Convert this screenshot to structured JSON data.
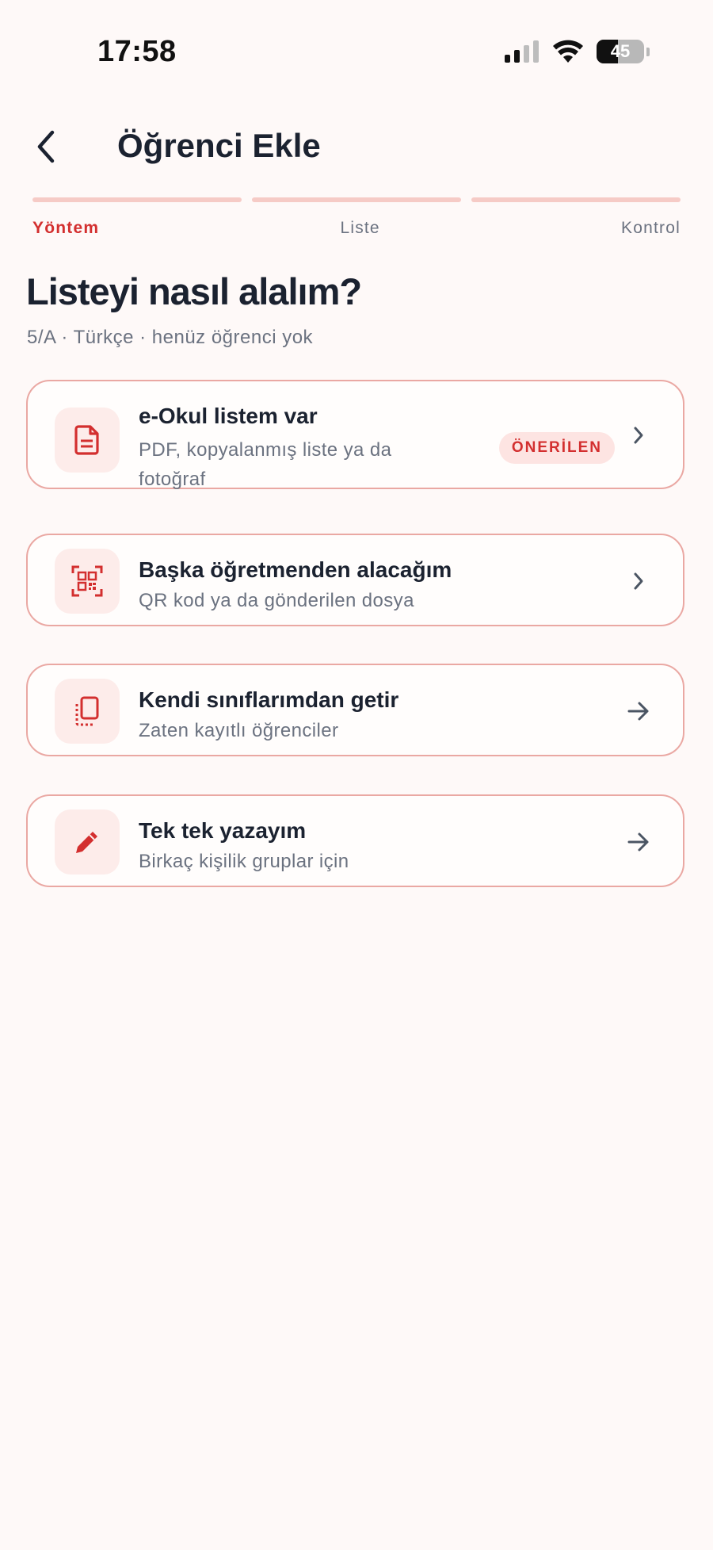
{
  "status_bar": {
    "time": "17:58",
    "battery_level": "45",
    "battery_fraction": 0.45
  },
  "header": {
    "title": "Öğrenci Ekle",
    "back_icon": "chevron-left-icon"
  },
  "stepper": {
    "steps": [
      {
        "label": "Yöntem",
        "active": true
      },
      {
        "label": "Liste",
        "active": false
      },
      {
        "label": "Kontrol",
        "active": false
      }
    ]
  },
  "main": {
    "heading": "Listeyi nasıl alalım?",
    "subheading": "5/A · Türkçe · henüz öğrenci yok"
  },
  "options": [
    {
      "title": "e-Okul listem var",
      "description": "PDF, kopyalanmış liste ya da fotoğraf",
      "badge": "ÖNERİLEN",
      "icon": "document-icon",
      "action_icon": "chevron-right-icon"
    },
    {
      "title": "Başka öğretmenden alacağım",
      "description": "QR kod ya da gönderilen dosya",
      "icon": "qr-code-icon",
      "action_icon": "chevron-right-icon"
    },
    {
      "title": "Kendi sınıflarımdan getir",
      "description": "Zaten kayıtlı öğrenciler",
      "icon": "copy-icon",
      "action_icon": "arrow-right-icon"
    },
    {
      "title": "Tek tek yazayım",
      "description": "Birkaç kişilik gruplar için",
      "icon": "pencil-icon",
      "action_icon": "arrow-right-icon"
    }
  ],
  "colors": {
    "accent": "#d32f2f",
    "card_border": "#eaa8a3",
    "icon_bg": "#fdecea",
    "background": "#fef9f8",
    "text_primary": "#1b2230",
    "text_secondary": "#6b7280"
  }
}
